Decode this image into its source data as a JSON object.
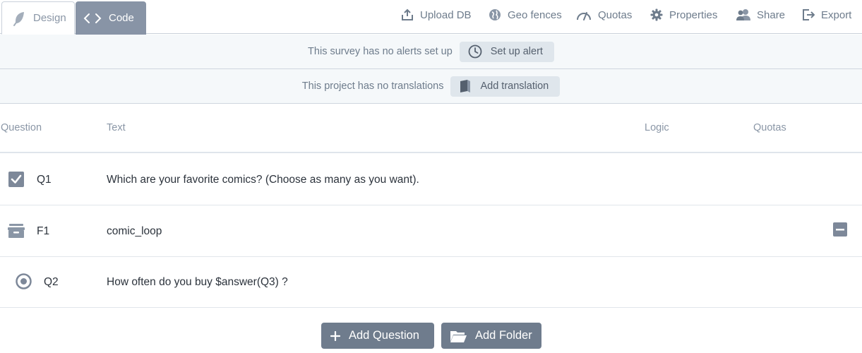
{
  "tabs": {
    "design": "Design",
    "code": "Code"
  },
  "menu": {
    "upload_db": "Upload DB",
    "geo_fences": "Geo fences",
    "quotas": "Quotas",
    "properties": "Properties",
    "share": "Share",
    "export": "Export"
  },
  "alerts": {
    "message": "This survey has no alerts set up",
    "button": "Set up alert"
  },
  "translations": {
    "message": "This project has no translations",
    "button": "Add translation"
  },
  "table": {
    "headers": {
      "question": "Question",
      "text": "Text",
      "logic": "Logic",
      "quotas": "Quotas"
    },
    "rows": [
      {
        "id": "Q1",
        "text": "Which are your favorite comics? (Choose as many as you want).",
        "icon": "checkbox-icon"
      },
      {
        "id": "F1",
        "text": "comic_loop",
        "icon": "folder-box-icon"
      },
      {
        "id": "Q2",
        "text": "How often do you buy $answer(Q3) ?",
        "icon": "radio-icon"
      }
    ]
  },
  "actions": {
    "add_question": "Add Question",
    "add_folder": "Add Folder"
  },
  "colors": {
    "accent": "#8894a6",
    "button": "#6f7c8d",
    "muted_text": "#6e7c8c"
  }
}
